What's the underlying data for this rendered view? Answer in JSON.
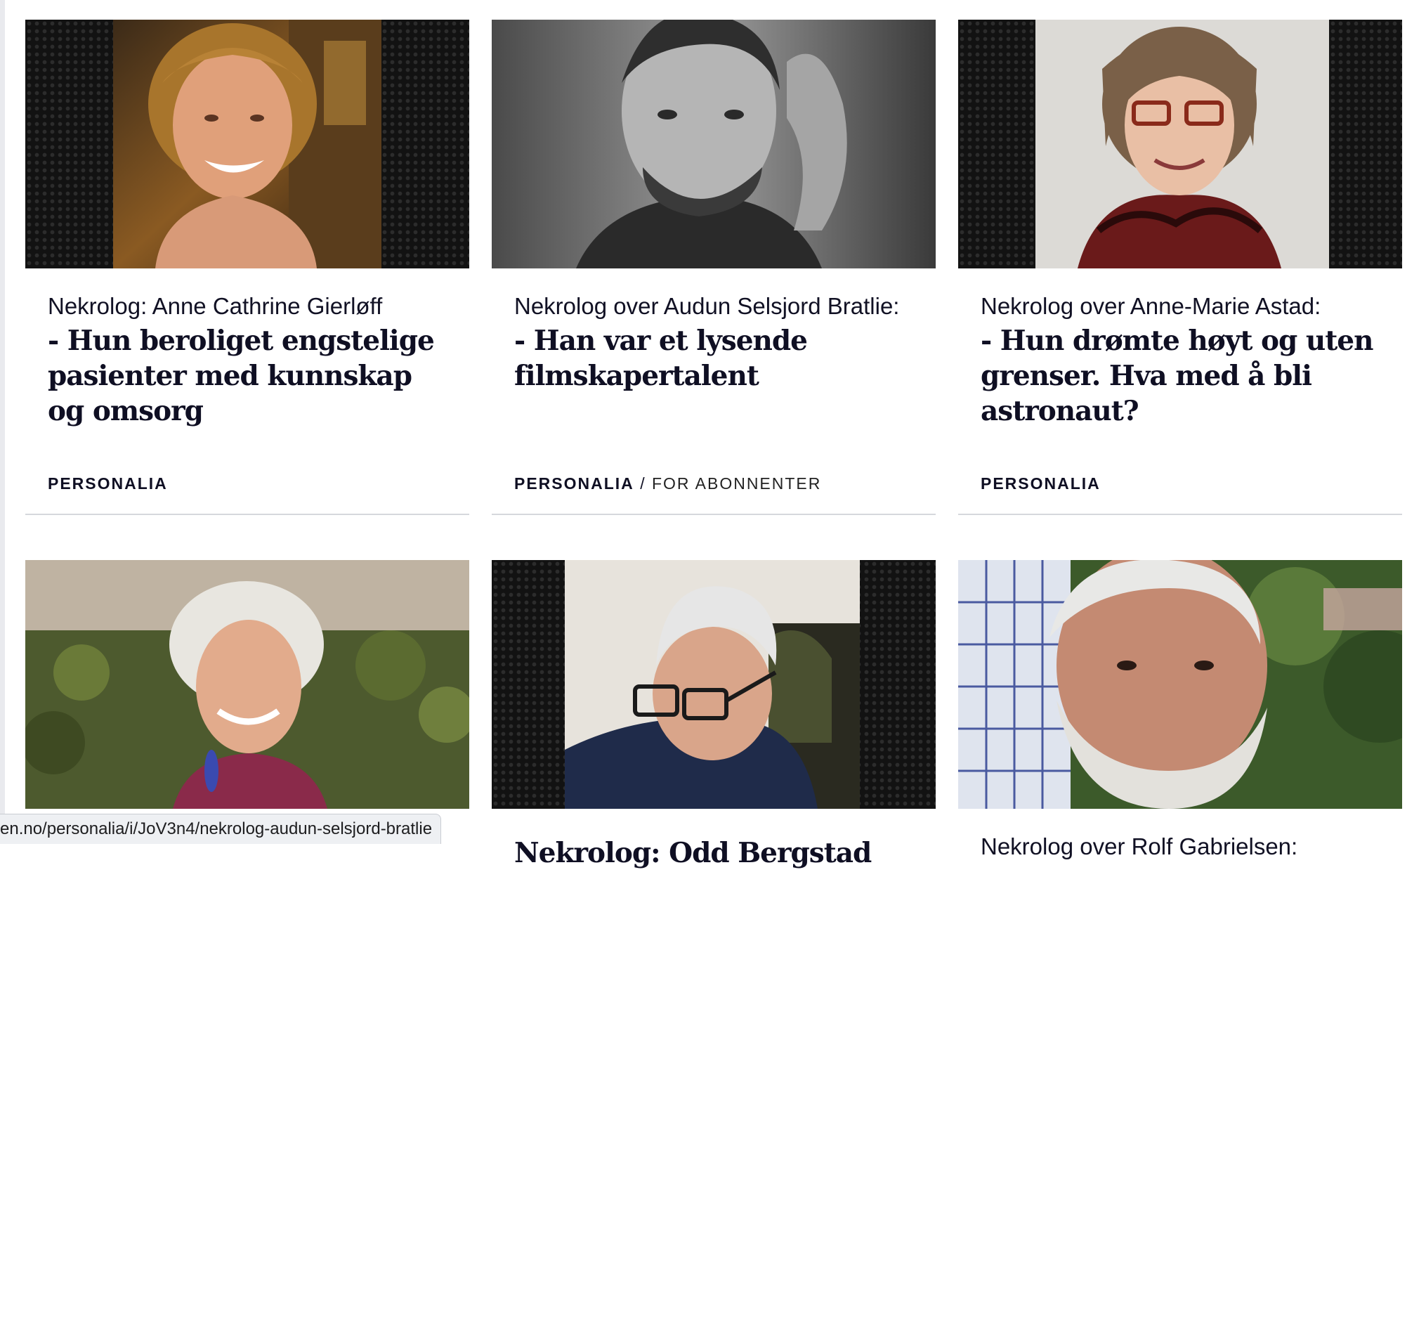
{
  "cards": [
    {
      "kicker": "Nekrolog: Anne Cathrine Gierløff",
      "headline": "- Hun beroliget engstelige pasienter med kunnskap og omsorg",
      "section": "PERSONALIA",
      "subscriber": ""
    },
    {
      "kicker": "Nekrolog over Audun Selsjord Bratlie:",
      "headline": "- Han var et lysende filmskapertalent",
      "section": "PERSONALIA",
      "separator": "/",
      "subscriber": "FOR ABONNENTER"
    },
    {
      "kicker": "Nekrolog over Anne-Marie Astad:",
      "headline": "- Hun drømte høyt og uten grenser. Hva med å bli astronaut?",
      "section": "PERSONALIA",
      "subscriber": ""
    },
    {
      "kicker": "",
      "headline": "",
      "section": "",
      "subscriber": ""
    },
    {
      "kicker": "",
      "headline": "Nekrolog: Odd Bergstad",
      "section": "",
      "subscriber": ""
    },
    {
      "kicker": "Nekrolog over Rolf Gabrielsen:",
      "headline": "",
      "section": "",
      "subscriber": ""
    }
  ],
  "status_url": "en.no/personalia/i/JoV3n4/nekrolog-audun-selsjord-bratlie",
  "colors": {
    "text": "#0f0f23",
    "divider": "#d6d8dc",
    "image_backdrop": "#121212"
  }
}
